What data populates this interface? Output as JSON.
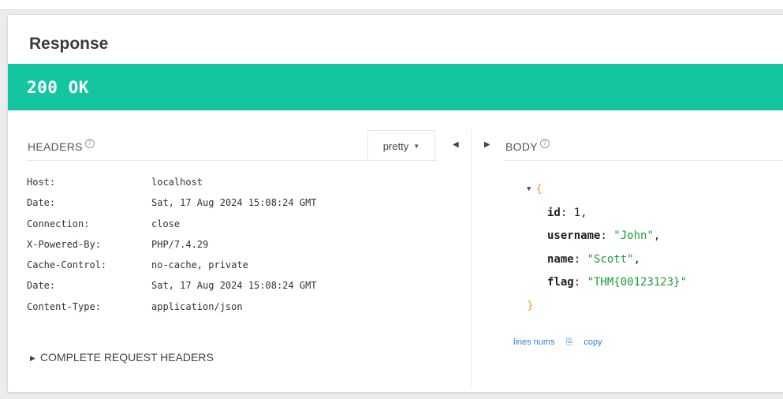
{
  "response": {
    "title": "Response",
    "status": "200 OK"
  },
  "headers": {
    "title": "HEADERS",
    "format_button": "pretty",
    "rows": [
      {
        "name": "Host:",
        "value": "localhost"
      },
      {
        "name": "Date:",
        "value": "Sat, 17 Aug 2024 15:08:24 GMT"
      },
      {
        "name": "Connection:",
        "value": "close"
      },
      {
        "name": "X-Powered-By:",
        "value": "PHP/7.4.29"
      },
      {
        "name": "Cache-Control:",
        "value": "no-cache, private"
      },
      {
        "name": "Date:",
        "value": "Sat, 17 Aug 2024 15:08:24 GMT"
      },
      {
        "name": "Content-Type:",
        "value": "application/json"
      }
    ],
    "complete_label": "COMPLETE REQUEST HEADERS"
  },
  "body": {
    "title": "BODY",
    "json": [
      {
        "key": "id",
        "value": "1",
        "type": "number"
      },
      {
        "key": "username",
        "value": "\"John\"",
        "type": "string"
      },
      {
        "key": "name",
        "value": "\"Scott\"",
        "type": "string"
      },
      {
        "key": "flag",
        "value": "\"THM{00123123}\"",
        "type": "string"
      }
    ],
    "actions": {
      "line_nums": "lines nums",
      "copy": "copy"
    }
  },
  "colors": {
    "status_bar": "#13c6a0",
    "json_string": "#1a9c3a",
    "json_brace": "#f0a030",
    "link": "#3a7bd5"
  }
}
